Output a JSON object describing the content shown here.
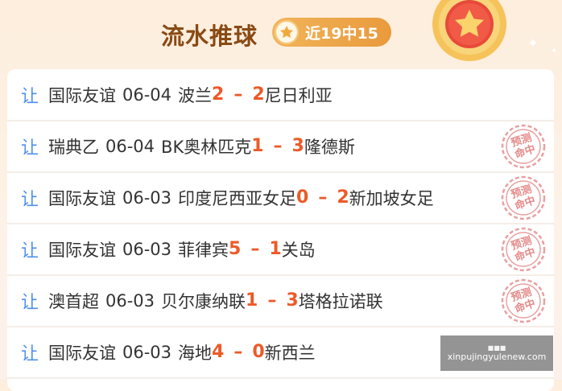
{
  "header": {
    "title": "流水推球",
    "badge_text": "近19中15"
  },
  "matches": [
    {
      "tag": "让",
      "league": "国际友谊",
      "date": "06-04",
      "home": "波兰",
      "home_score": "2",
      "away_score": "2",
      "away": "尼日利亚",
      "hit": false
    },
    {
      "tag": "让",
      "league": "瑞典乙",
      "date": "06-04",
      "home": "BK奥林匹克",
      "home_score": "1",
      "away_score": "3",
      "away": "隆德斯",
      "hit": true
    },
    {
      "tag": "让",
      "league": "国际友谊",
      "date": "06-03",
      "home": "印度尼西亚女足",
      "home_score": "0",
      "away_score": "2",
      "away": "新加坡女足",
      "hit": true
    },
    {
      "tag": "让",
      "league": "国际友谊",
      "date": "06-03",
      "home": "菲律宾",
      "home_score": "5",
      "away_score": "1",
      "away": "关岛",
      "hit": true
    },
    {
      "tag": "让",
      "league": "澳首超",
      "date": "06-03",
      "home": "贝尔康纳联",
      "home_score": "1",
      "away_score": "3",
      "away": "塔格拉诺联",
      "hit": true
    },
    {
      "tag": "让",
      "league": "国际友谊",
      "date": "06-03",
      "home": "海地",
      "home_score": "4",
      "away_score": "0",
      "away": "新西兰",
      "hit": false
    }
  ],
  "stamp": {
    "line1": "预测",
    "line2": "命中"
  },
  "score_separator": "–",
  "watermark": {
    "line1": "■■■",
    "line2": "xinpujingyulenew.com"
  },
  "colors": {
    "tag": "#4f8ff0",
    "score": "#ec5a28",
    "title": "#8a4a14",
    "stamp": "#e58a8a"
  }
}
